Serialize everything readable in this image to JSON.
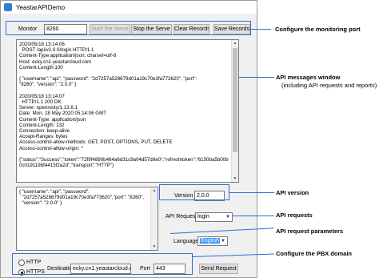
{
  "window": {
    "title": "YeastarAPIDemo"
  },
  "monitor": {
    "label": "Monitor",
    "port_value": "8260",
    "start_label": "Start the Serve",
    "stop_label": "Stop the Serve",
    "clear_label": "Clear Records",
    "save_label": "Save Records"
  },
  "messages": {
    "text": "2020/05/18 13:14:06\n  POST /api/v2.0.0/login HTTP/1.1\nContent-Type:application/json; charset=utf-8\nHost: ecky.cn1.yeastarcloud.com\nContent-Length:100\n\n{ \"username\": \"api\", \"password\": \"2d7257a528679d01a19c70e3fa773620\", \"port\":\n\"8260\", \"version\": \"2.0.0\" }\n\n2020/05/18 13:14:07\n  HTTP/1.1 200 OK\nServer: openresty/1.13.6.1\nDate: Mon, 18 May 2020 05:14:06 GMT\nContent-Type: application/json\nContent-Length: 132\nConnection: keep-alive\nAccept-Ranges: bytes\nAccess-control-allow-methods: GET, POST, OPTIONS, PUT, DELETE\nAccess-control-allow-origin: *\n\n{\"status\":\"Success\",\"token\":\"72f9f4890b464a6d31c9a04d57d8e0\",\"refreshtoken\":\"6150ba5b00b\n0c019119bf4415f2a2d\",\"transport\":\"HTTP\"}"
  },
  "request": {
    "params_text": "{ \"username\": \"api\", \"password\":\n  \"2d7257a528679d01a19c70e3fa773620\",\"port\": \"8260\",\n  \"version\": \"2.0.0\" }",
    "version_label": "Version",
    "version_value": "2.0.0",
    "api_request_label": "API Request",
    "api_request_value": "login",
    "language_label": "Language",
    "language_value": "English"
  },
  "domain": {
    "http_label": "HTTP",
    "https_label": "HTTPS",
    "protocol_selected": "HTTPS",
    "destination_label": "Destinatio",
    "destination_value": "ecky.cn1.yeastarcloud.com",
    "port_label": "Port",
    "port_value": "443",
    "send_label": "Send Request"
  },
  "annotations": {
    "configure_port": "Configure the monitoring port",
    "messages_title": "API messages window",
    "messages_sub": "(including API requests and reports)",
    "api_version": "API version",
    "api_requests": "API requests",
    "api_params": "API request parameters",
    "pbx_domain": "Configure the PBX domain"
  },
  "colors": {
    "annotation": "#2b6fd6",
    "selection": "#3399ff",
    "window_bg": "#f0f0f0"
  }
}
